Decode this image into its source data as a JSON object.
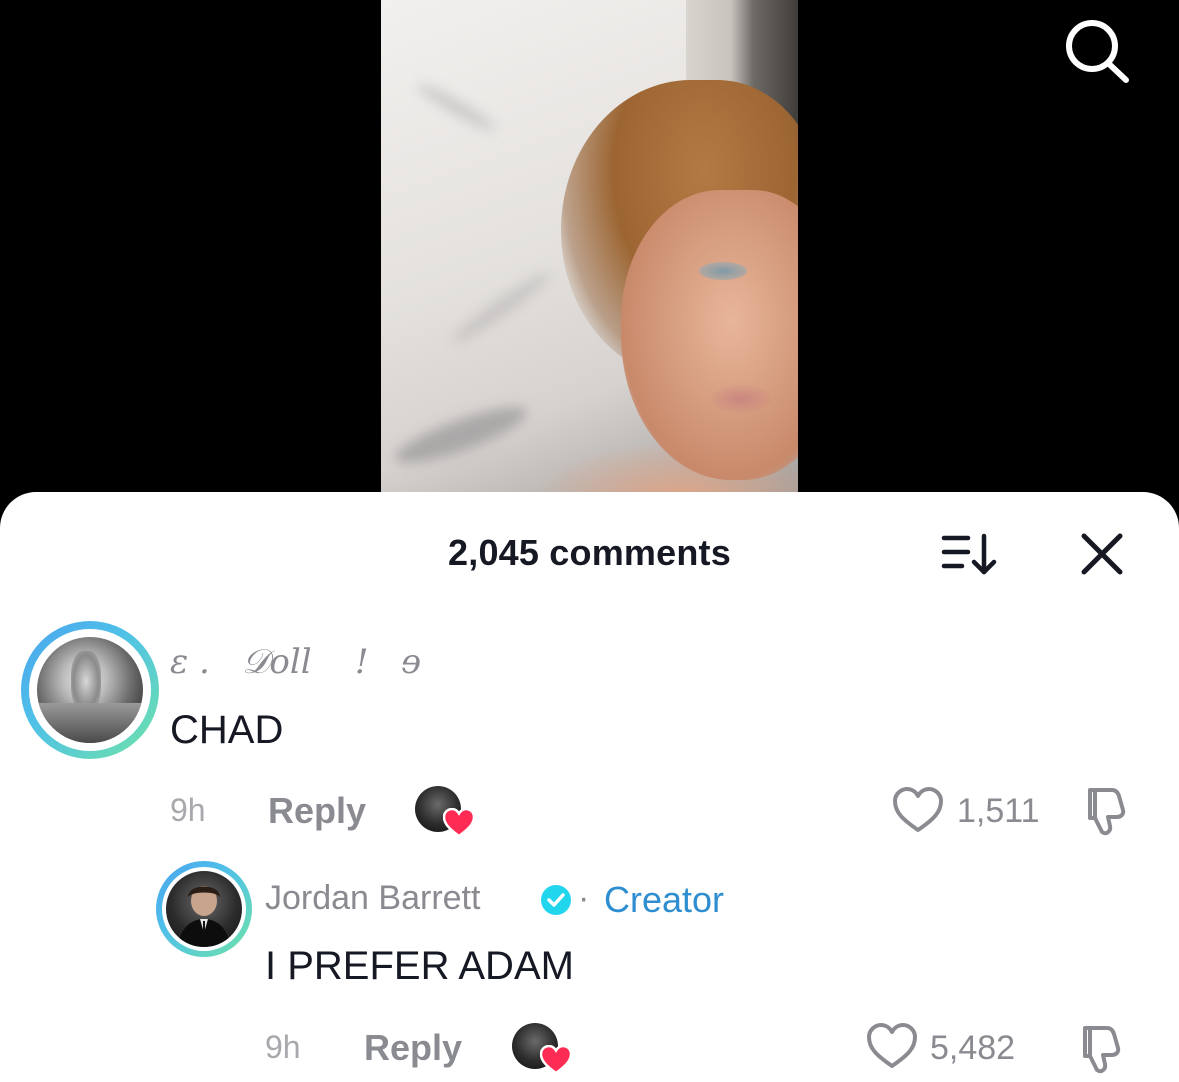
{
  "header": {
    "comments_title": "2,045 comments",
    "search_icon": "search-icon",
    "sort_icon": "sort-icon",
    "close_icon": "close-icon"
  },
  "comments": [
    {
      "username": "ɛ .   𝒟oll    !   ɘ",
      "text": "CHAD",
      "time": "9h",
      "reply_label": "Reply",
      "likes": "1,511",
      "liked_by_creator": true
    },
    {
      "username": "Jordan Barrett",
      "verified": true,
      "separator": "·",
      "badge": "Creator",
      "text": "I PREFER ADAM",
      "time": "9h",
      "reply_label": "Reply",
      "likes": "5,482",
      "liked_by_creator": true
    }
  ],
  "colors": {
    "accent": "#2e8ecf",
    "heart": "#fe2c55",
    "verified": "#20d5ec"
  }
}
